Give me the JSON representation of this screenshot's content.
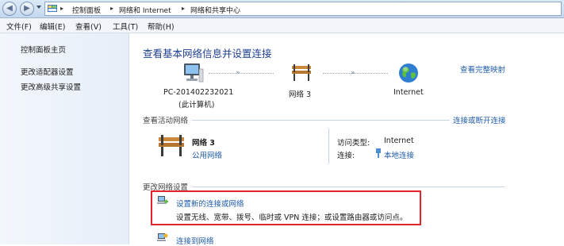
{
  "address_bar": {
    "breadcrumbs": [
      "控制面板",
      "网络和 Internet",
      "网络和共享中心"
    ]
  },
  "menu": {
    "items": [
      "文件(F)",
      "编辑(E)",
      "查看(V)",
      "工具(T)",
      "帮助(H)"
    ]
  },
  "sidebar": {
    "items": [
      "控制面板主页",
      "更改适配器设置",
      "更改高级共享设置"
    ]
  },
  "main": {
    "title": "查看基本网络信息并设置连接",
    "full_map_link": "查看完整映射",
    "map": {
      "computer_name": "PC-201402232021",
      "computer_sub": "(此计算机)",
      "network_name": "网络  3",
      "internet_label": "Internet"
    },
    "active_section": {
      "heading": "查看活动网络",
      "connect_link": "连接或断开连接",
      "network_name": "网络  3",
      "network_type": "公用网络",
      "access_type_label": "访问类型:",
      "access_type_value": "Internet",
      "connection_label": "连接:",
      "connection_value": "本地连接"
    },
    "change_section": {
      "heading": "更改网络设置",
      "tasks": [
        {
          "title": "设置新的连接或网络",
          "desc": "设置无线、宽带、拨号、临时或 VPN 连接；或设置路由器或访问点。"
        },
        {
          "title": "连接到网络",
          "desc": ""
        }
      ]
    }
  },
  "colors": {
    "highlight_box": "#e2262b",
    "link": "#1e5ba8",
    "title": "#1e3f8f"
  }
}
